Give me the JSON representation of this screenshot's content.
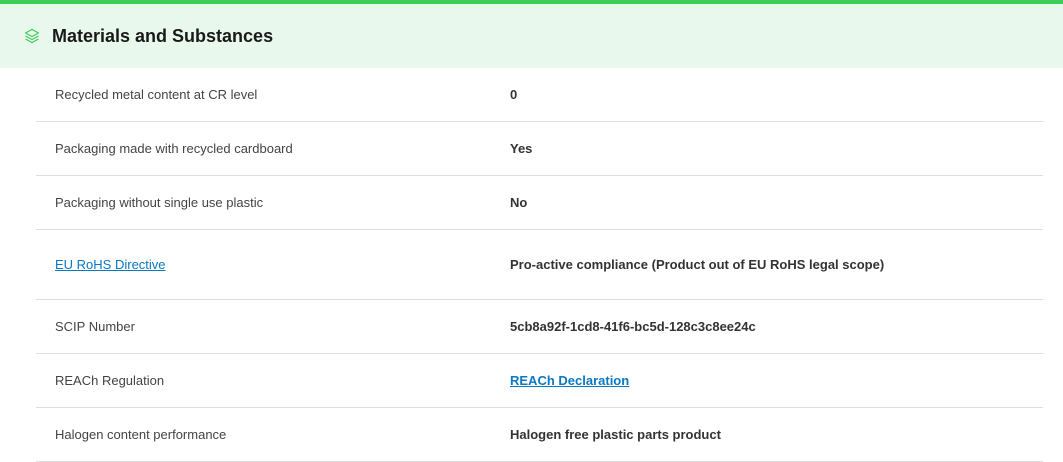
{
  "colors": {
    "accent": "#3dcd58",
    "header_bg": "#e9f8ec",
    "link": "#0b78c2",
    "divider": "#dedede"
  },
  "section": {
    "title": "Materials and Substances",
    "icon": "layers-icon"
  },
  "rows": [
    {
      "label": "Recycled metal content at CR level",
      "value": "0"
    },
    {
      "label": "Packaging made with recycled cardboard",
      "value": "Yes"
    },
    {
      "label": "Packaging without single use plastic",
      "value": "No"
    },
    {
      "label": "EU RoHS Directive",
      "value": "Pro-active compliance (Product out of EU RoHS legal scope)",
      "label_is_link": true
    },
    {
      "label": "SCIP Number",
      "value": "5cb8a92f-1cd8-41f6-bc5d-128c3c8ee24c"
    },
    {
      "label": "REACh Regulation",
      "value": "REACh Declaration",
      "value_is_link": true
    },
    {
      "label": "Halogen content performance",
      "value": "Halogen free plastic parts product"
    }
  ]
}
